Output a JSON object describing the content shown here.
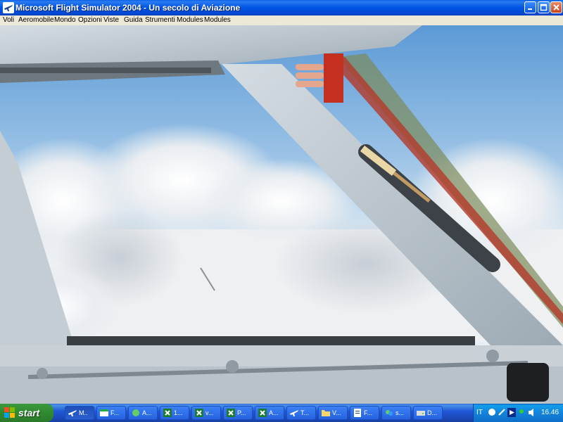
{
  "window": {
    "title": "Microsoft Flight Simulator 2004 - Un secolo di Aviazione",
    "icon": "airplane-icon",
    "controls": [
      "minimize-icon",
      "maximize-icon",
      "close-icon"
    ]
  },
  "menu": [
    "Voli",
    "Aeromobile",
    "Mondo",
    "Opzioni",
    "Viste",
    "Guida",
    "Strumenti",
    "Modules",
    "Modules"
  ],
  "scene": {
    "description_icon": "cockpit-window-view"
  },
  "taskbar": {
    "start_label": "start",
    "tasks": [
      {
        "label": "M..",
        "icon": "airplane-icon"
      },
      {
        "label": "F...",
        "icon": "window-icon"
      },
      {
        "label": "A...",
        "icon": "network-icon"
      },
      {
        "label": "1...",
        "icon": "excel-icon"
      },
      {
        "label": "v...",
        "icon": "excel-icon"
      },
      {
        "label": "P...",
        "icon": "excel-icon"
      },
      {
        "label": "A...",
        "icon": "excel-icon"
      },
      {
        "label": "T...",
        "icon": "airplane-icon"
      },
      {
        "label": "V...",
        "icon": "folder-icon"
      },
      {
        "label": "F...",
        "icon": "document-icon"
      },
      {
        "label": "s...",
        "icon": "messenger-icon"
      },
      {
        "label": "D...",
        "icon": "drive-icon"
      }
    ],
    "tray": {
      "language": "IT",
      "clock": "16.46"
    }
  }
}
